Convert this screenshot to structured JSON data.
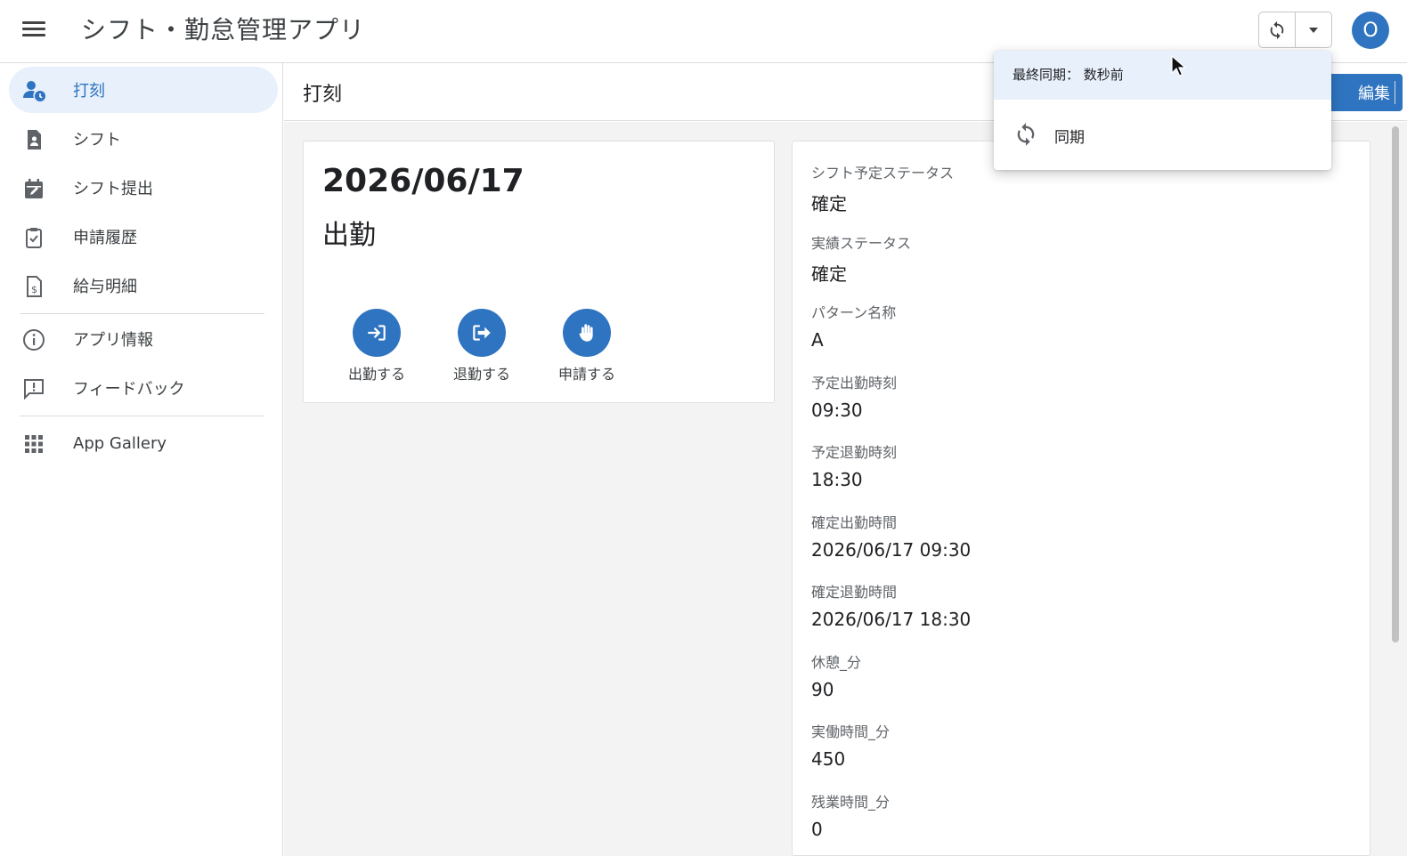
{
  "app": {
    "title": "シフト・勤怠管理アプリ",
    "avatar_initial": "O",
    "accent_color": "#2f74c0"
  },
  "sidebar": {
    "items": [
      {
        "label": "打刻",
        "icon": "person-clock-icon",
        "active": true
      },
      {
        "label": "シフト",
        "icon": "document-person-icon"
      },
      {
        "label": "シフト提出",
        "icon": "calendar-edit-icon"
      },
      {
        "label": "申請履歴",
        "icon": "clipboard-check-icon"
      },
      {
        "label": "給与明細",
        "icon": "receipt-dollar-icon"
      },
      {
        "label": "アプリ情報",
        "icon": "info-icon"
      },
      {
        "label": "フィードバック",
        "icon": "feedback-icon"
      },
      {
        "label": "App Gallery",
        "icon": "apps-grid-icon"
      }
    ]
  },
  "header": {
    "page_title": "打刻",
    "edit_label": "編集"
  },
  "punch_card": {
    "date": "2026/06/17",
    "status": "出勤",
    "actions": [
      {
        "label": "出勤する",
        "icon": "clock-in-icon"
      },
      {
        "label": "退勤する",
        "icon": "clock-out-icon"
      },
      {
        "label": "申請する",
        "icon": "hand-icon"
      }
    ]
  },
  "details": {
    "fields": [
      {
        "label": "シフト予定ステータス",
        "value": "確定"
      },
      {
        "label": "実績ステータス",
        "value": "確定"
      },
      {
        "label": "パターン名称",
        "value": "A"
      },
      {
        "label": "予定出勤時刻",
        "value": "09:30"
      },
      {
        "label": "予定退勤時刻",
        "value": "18:30"
      },
      {
        "label": "確定出勤時間",
        "value": "2026/06/17 09:30"
      },
      {
        "label": "確定退勤時間",
        "value": "2026/06/17 18:30"
      },
      {
        "label": "休憩_分",
        "value": "90"
      },
      {
        "label": "実働時間_分",
        "value": "450"
      },
      {
        "label": "残業時間_分",
        "value": "0"
      }
    ]
  },
  "sync_menu": {
    "last_sync": "最終同期： 数秒前",
    "sync_label": "同期"
  }
}
